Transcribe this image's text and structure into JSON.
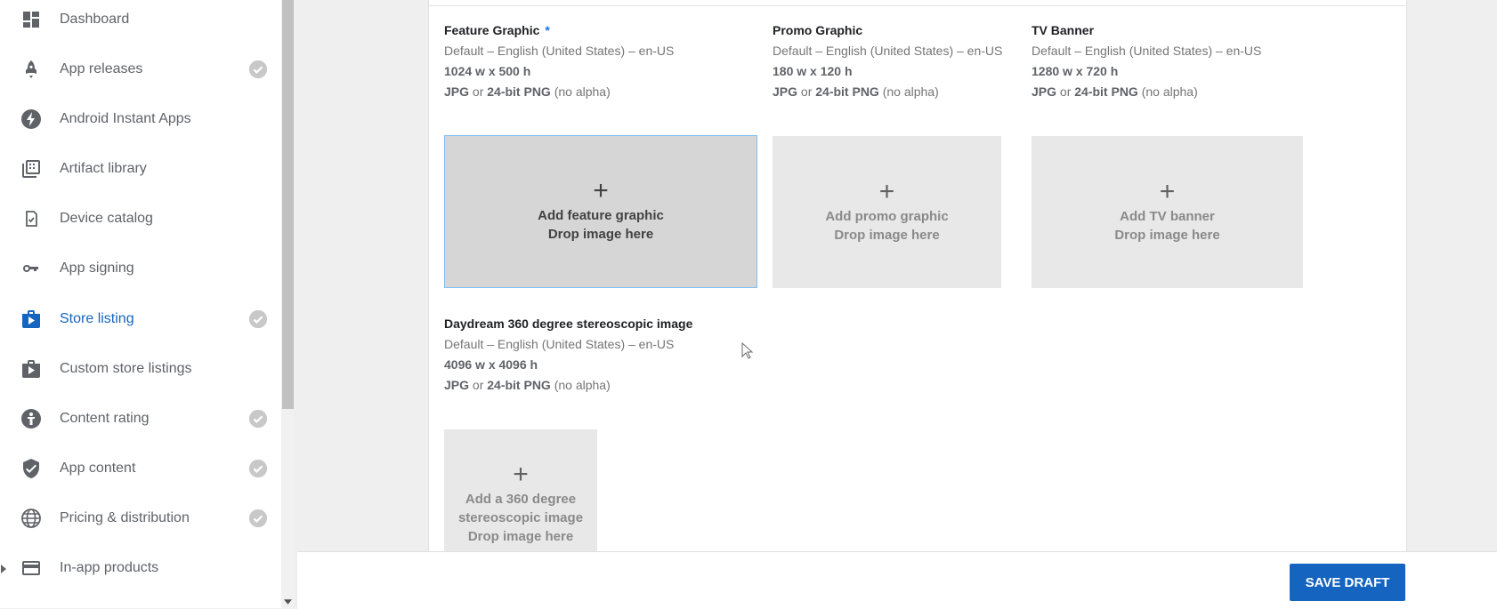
{
  "sidebar": {
    "items": [
      {
        "label": "Dashboard",
        "icon": "dashboard-icon",
        "checked": false
      },
      {
        "label": "App releases",
        "icon": "rocket-icon",
        "checked": true
      },
      {
        "label": "Android Instant Apps",
        "icon": "bolt-icon",
        "checked": false
      },
      {
        "label": "Artifact library",
        "icon": "library-icon",
        "checked": false
      },
      {
        "label": "Device catalog",
        "icon": "device-check-icon",
        "checked": false
      },
      {
        "label": "App signing",
        "icon": "key-icon",
        "checked": false
      },
      {
        "label": "Store listing",
        "icon": "store-icon",
        "checked": true,
        "active": true
      },
      {
        "label": "Custom store listings",
        "icon": "store-icon",
        "checked": false
      },
      {
        "label": "Content rating",
        "icon": "rating-icon",
        "checked": true
      },
      {
        "label": "App content",
        "icon": "shield-check-icon",
        "checked": true
      },
      {
        "label": "Pricing & distribution",
        "icon": "globe-icon",
        "checked": true
      },
      {
        "label": "In-app products",
        "icon": "credit-card-icon",
        "checked": false,
        "expandable": true
      }
    ]
  },
  "assets": {
    "feature": {
      "title": "Feature Graphic",
      "required_mark": "*",
      "language": "Default – English (United States) – en-US",
      "size": "1024 w x 500 h",
      "format_a": "JPG",
      "format_or": " or ",
      "format_b": "24-bit PNG",
      "format_c": " (no alpha)",
      "drop_plus": "+",
      "drop_label": "Add feature graphic",
      "drop_hint": "Drop image here"
    },
    "promo": {
      "title": "Promo Graphic",
      "language": "Default – English (United States) – en-US",
      "size": "180 w x 120 h",
      "format_a": "JPG",
      "format_or": " or ",
      "format_b": "24-bit PNG",
      "format_c": " (no alpha)",
      "drop_plus": "+",
      "drop_label": "Add promo graphic",
      "drop_hint": "Drop image here"
    },
    "tv": {
      "title": "TV Banner",
      "language": "Default – English (United States) – en-US",
      "size": "1280 w x 720 h",
      "format_a": "JPG",
      "format_or": " or ",
      "format_b": "24-bit PNG",
      "format_c": " (no alpha)",
      "drop_plus": "+",
      "drop_label": "Add TV banner",
      "drop_hint": "Drop image here"
    },
    "daydream": {
      "title": "Daydream 360 degree stereoscopic image",
      "language": "Default – English (United States) – en-US",
      "size": "4096 w x 4096 h",
      "format_a": "JPG",
      "format_or": " or ",
      "format_b": "24-bit PNG",
      "format_c": " (no alpha)",
      "drop_plus": "+",
      "drop_label_1": "Add a 360 degree",
      "drop_label_2": "stereoscopic image",
      "drop_hint": "Drop image here"
    }
  },
  "footer": {
    "save_label": "SAVE DRAFT"
  },
  "colors": {
    "accent": "#1565c0",
    "check": "#bdbdbd",
    "focus_border": "#81bff0"
  }
}
